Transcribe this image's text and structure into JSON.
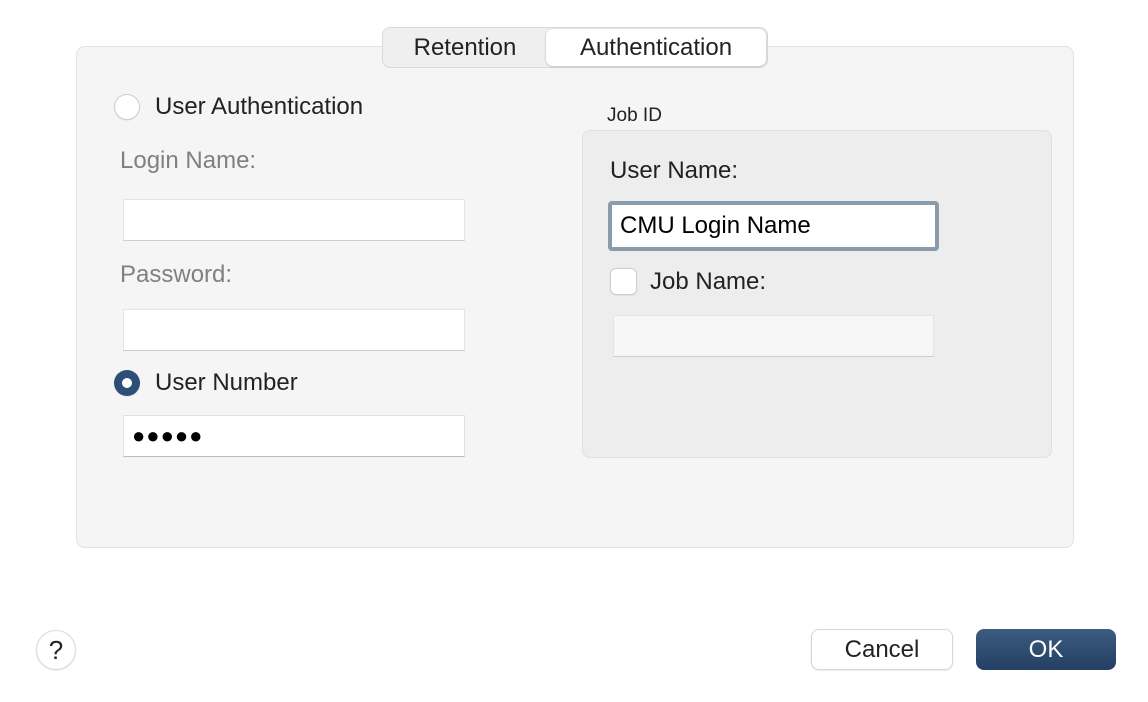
{
  "tabs": [
    {
      "label": "Retention",
      "selected": false
    },
    {
      "label": "Authentication",
      "selected": true
    }
  ],
  "authentication": {
    "user_auth_label": "User Authentication",
    "user_auth_selected": false,
    "login_name_label": "Login Name:",
    "login_name_value": "",
    "password_label": "Password:",
    "password_value": "",
    "user_number_label": "User Number",
    "user_number_selected": true,
    "user_number_value": "●●●●●"
  },
  "job_id": {
    "group_label": "Job ID",
    "user_name_label": "User Name:",
    "user_name_value": "CMU Login Name",
    "job_name_label": "Job Name:",
    "job_name_checked": false,
    "job_name_value": ""
  },
  "footer": {
    "help_label": "?",
    "cancel_label": "Cancel",
    "ok_label": "OK"
  },
  "colors": {
    "accent": "#2e4f75",
    "ok_button": "#2c4a6e",
    "focus_ring": "#8a9bab"
  }
}
